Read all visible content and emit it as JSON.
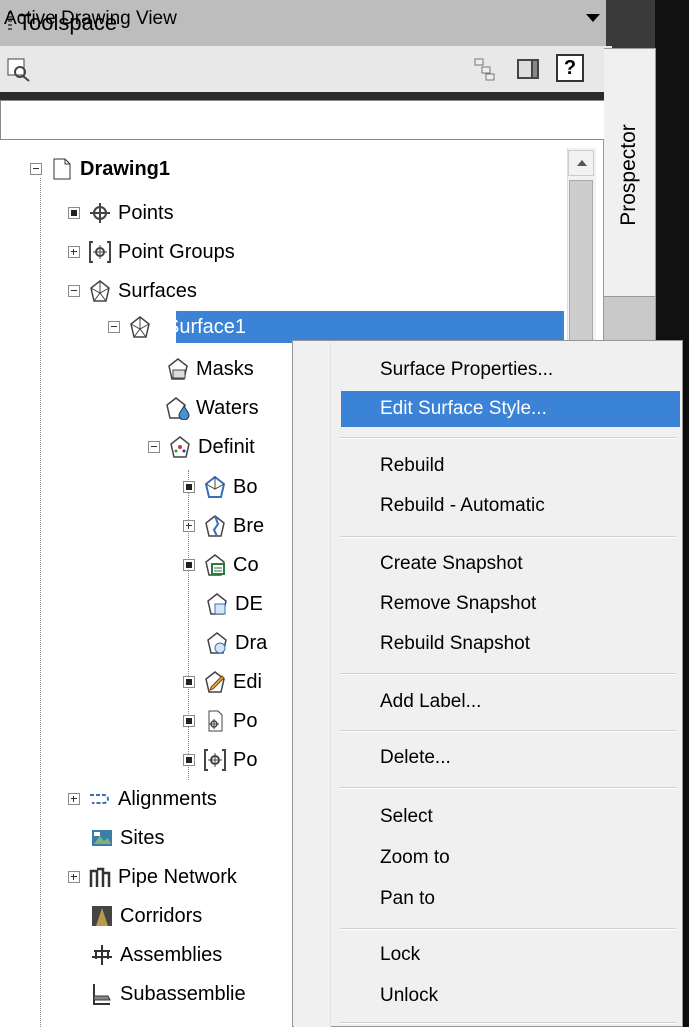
{
  "window": {
    "title": "Toolspace",
    "side_tab_label": "Prospector"
  },
  "toolbar": {
    "icons": [
      "zoom-to-icon",
      "item-view-icon",
      "toolspace-options-icon",
      "help-icon"
    ],
    "help_label": "?"
  },
  "view_select": {
    "value": "Active Drawing View"
  },
  "tree": {
    "root": "Drawing1",
    "items": [
      {
        "label": "Points"
      },
      {
        "label": "Point Groups"
      },
      {
        "label": "Surfaces"
      },
      {
        "label": "Surface1"
      },
      {
        "label": "Masks"
      },
      {
        "label": "Waters"
      },
      {
        "label": "Definit"
      },
      {
        "label": "Bo"
      },
      {
        "label": "Bre"
      },
      {
        "label": "Co"
      },
      {
        "label": "DE"
      },
      {
        "label": "Dra"
      },
      {
        "label": "Edi"
      },
      {
        "label": "Po"
      },
      {
        "label": "Po"
      },
      {
        "label": "Alignments"
      },
      {
        "label": "Sites"
      },
      {
        "label": "Pipe Network"
      },
      {
        "label": "Corridors"
      },
      {
        "label": "Assemblies"
      },
      {
        "label": "Subassemblie"
      }
    ]
  },
  "context_menu": {
    "items": [
      "Surface Properties...",
      "Edit Surface Style...",
      "Rebuild",
      "Rebuild - Automatic",
      "Create Snapshot",
      "Remove Snapshot",
      "Rebuild Snapshot",
      "Add Label...",
      "Delete...",
      "Select",
      "Zoom to",
      "Pan to",
      "Lock",
      "Unlock"
    ],
    "highlighted": "Edit Surface Style..."
  },
  "colors": {
    "selection": "#3a83d6",
    "menu_bg": "#f0f0f0"
  }
}
